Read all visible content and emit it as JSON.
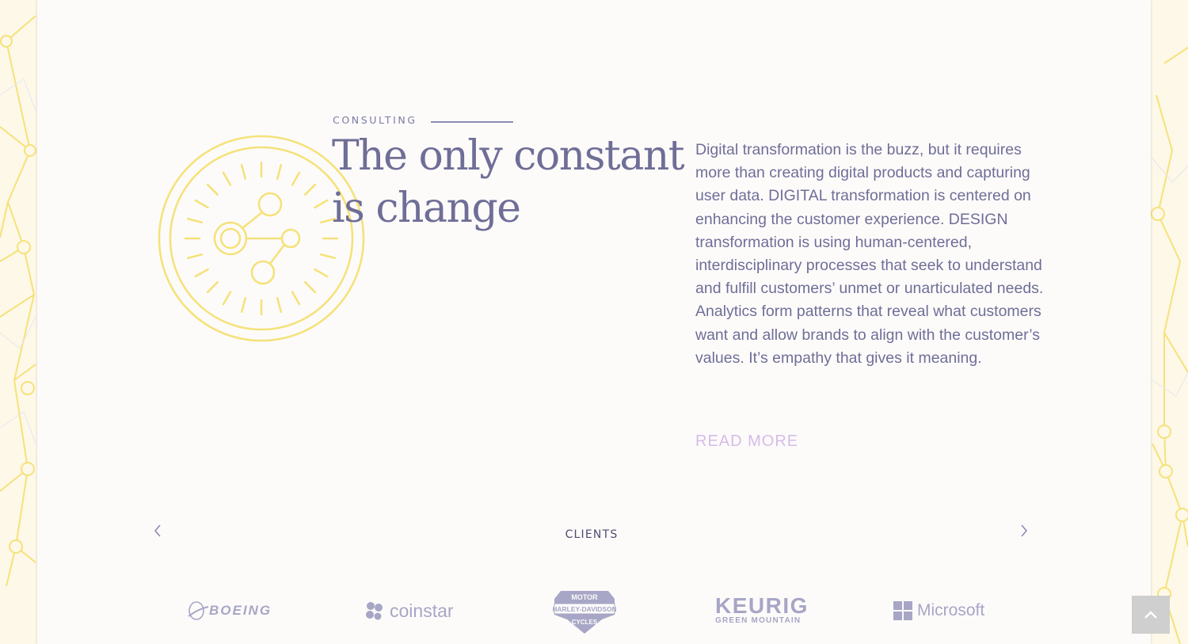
{
  "section": {
    "eyebrow": "CONSULTING",
    "headline": "The only constant is change",
    "body": "Digital transformation is the buzz, but it requires more than creating digital products and capturing user data. DIGITAL transformation is centered on enhancing the customer experience. DESIGN transformation is using human-centered, interdisciplinary processes that seek to understand and fulfill customers’ unmet or unarticulated needs. Analytics form patterns that reveal what customers want and allow brands to align with the customer’s values. It’s empathy that gives it meaning.",
    "read_more": "READ MORE",
    "icon": "gauge-network-icon"
  },
  "clients": {
    "title": "CLIENTS",
    "prev_icon": "chevron-left-icon",
    "next_icon": "chevron-right-icon",
    "logos": [
      {
        "name": "BOEING",
        "icon": "boeing-logo"
      },
      {
        "name": "coinstar",
        "icon": "coinstar-logo"
      },
      {
        "name": "HARLEY-DAVIDSON",
        "icon": "harley-davidson-logo",
        "text_top": "MOTOR",
        "text_bottom": "CYCLES"
      },
      {
        "name": "KEURIG",
        "sub": "GREEN MOUNTAIN",
        "icon": "keurig-logo"
      },
      {
        "name": "Microsoft",
        "icon": "microsoft-logo"
      }
    ]
  },
  "back_to_top": {
    "icon": "chevron-up-icon"
  },
  "colors": {
    "accent_purple": "#6f6e97",
    "link_lavender": "#d5bce8",
    "icon_yellow": "#f5e27a",
    "logo_gray": "#a7a6c6"
  }
}
